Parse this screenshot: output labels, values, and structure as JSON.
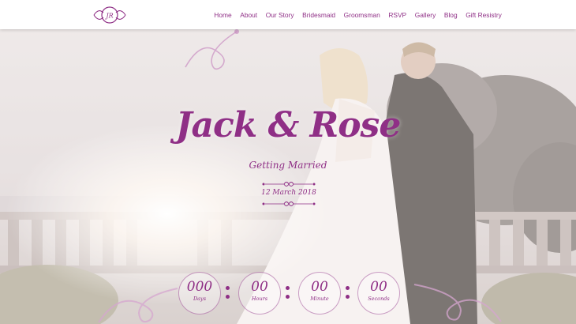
{
  "nav": {
    "items": [
      "Home",
      "About",
      "Our Story",
      "Bridesmaid",
      "Groomsman",
      "RSVP",
      "Gallery",
      "Blog",
      "Gift Resistry"
    ]
  },
  "logo": {
    "monogram": "JR"
  },
  "hero": {
    "title": "Jack & Rose",
    "subtitle": "Getting Married",
    "date": "12 March 2018"
  },
  "countdown": [
    {
      "value": "000",
      "label": "Days"
    },
    {
      "value": "00",
      "label": "Hours"
    },
    {
      "value": "00",
      "label": "Minute"
    },
    {
      "value": "00",
      "label": "Seconds"
    }
  ],
  "colors": {
    "accent": "#8f2f86"
  }
}
